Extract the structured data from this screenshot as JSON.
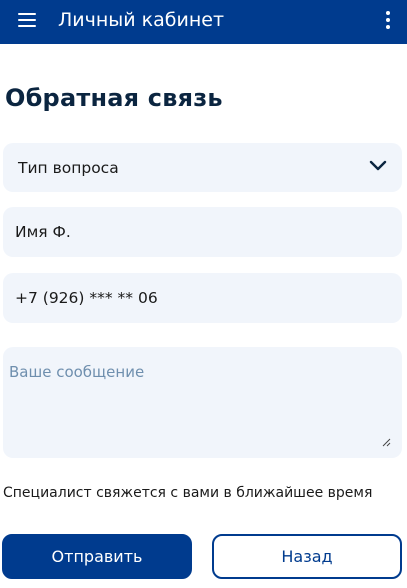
{
  "header": {
    "title": "Личный кабинет",
    "menu_icon": "hamburger-menu-icon",
    "more_icon": "vertical-dots-icon",
    "background_color": "#003b8e"
  },
  "page": {
    "title": "Обратная связь"
  },
  "form": {
    "question_type": {
      "selected": "Тип вопроса",
      "icon": "chevron-down-icon"
    },
    "name": {
      "value": "Имя Ф."
    },
    "phone": {
      "value": "+7 (926) *** ** 06"
    },
    "message": {
      "value": "",
      "placeholder": "Ваше сообщение"
    },
    "hint": "Специалист свяжется с вами в ближайшее время"
  },
  "actions": {
    "send_label": "Отправить",
    "back_label": "Назад"
  },
  "colors": {
    "primary": "#003b8e",
    "field_background": "#f1f5fb",
    "title_text": "#0b2540"
  }
}
